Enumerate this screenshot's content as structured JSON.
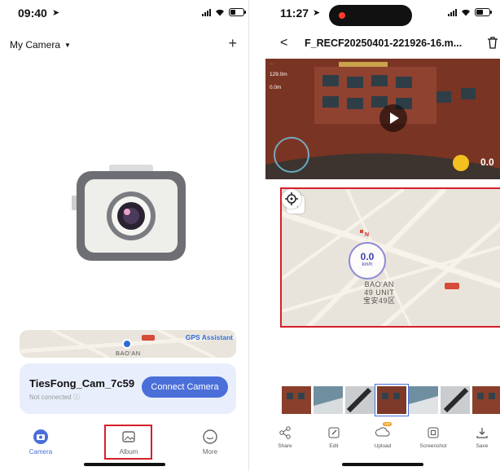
{
  "left_phone": {
    "status": {
      "time": "09:40"
    },
    "header": {
      "camera_selector_label": "My Camera"
    },
    "map_preview": {
      "gps_assistant": "GPS Assistant",
      "place_label": "BAO'AN"
    },
    "device": {
      "name": "TiesFong_Cam_7c59",
      "status": "Not connected ⓘ",
      "connect_label": "Connect Camera"
    },
    "tabs": [
      {
        "label": "Camera",
        "icon": "camera-tab-icon",
        "active": true
      },
      {
        "label": "Album",
        "icon": "album-tab-icon",
        "active": false,
        "highlighted": true
      },
      {
        "label": "More",
        "icon": "more-tab-icon",
        "active": false
      }
    ]
  },
  "right_phone": {
    "status": {
      "time": "11:27"
    },
    "header": {
      "title": "F_RECF20250401-221926-16.m..."
    },
    "video_overlay": {
      "altitude": "129.0m",
      "distance": "0.0m",
      "speed": "0.0"
    },
    "map": {
      "speed_value": "0.0",
      "speed_unit": "km/h",
      "north": "N",
      "place_line1": "BAO'AN",
      "place_line2": "49 UNIT",
      "place_line3": "宝安49区"
    },
    "thumbnails_count": 8,
    "actions": [
      {
        "label": "Share",
        "icon": "share-icon"
      },
      {
        "label": "Edit",
        "icon": "edit-icon"
      },
      {
        "label": "Upload",
        "icon": "upload-icon",
        "badge": "VIP"
      },
      {
        "label": "Screenshot",
        "icon": "screenshot-icon"
      },
      {
        "label": "Save",
        "icon": "save-icon"
      }
    ]
  },
  "colors": {
    "accent": "#4a6fd9",
    "highlight": "#d61f2b",
    "card": "#e8eefb"
  }
}
